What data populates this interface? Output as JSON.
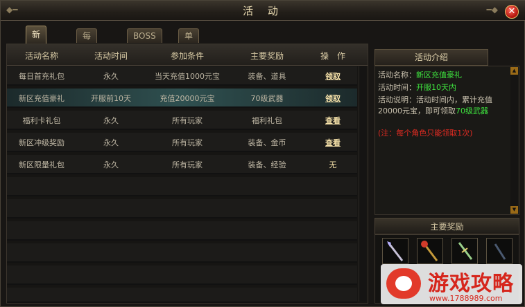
{
  "window": {
    "title": "活 动"
  },
  "tabs": [
    "新区活动",
    "每日活动",
    "BOSS信息",
    "单人副本"
  ],
  "table": {
    "headers": [
      "活动名称",
      "活动时间",
      "参加条件",
      "主要奖励",
      "操　作"
    ],
    "rows": [
      {
        "name": "每日首充礼包",
        "time": "永久",
        "cond": "当天充值1000元宝",
        "reward": "装备、道具",
        "op": "领取"
      },
      {
        "name": "新区充值豪礼",
        "time": "开服前10天",
        "cond": "充值20000元宝",
        "reward": "70级武器",
        "op": "领取"
      },
      {
        "name": "福利卡礼包",
        "time": "永久",
        "cond": "所有玩家",
        "reward": "福利礼包",
        "op": "查看"
      },
      {
        "name": "新区冲级奖励",
        "time": "永久",
        "cond": "所有玩家",
        "reward": "装备、金币",
        "op": "查看"
      },
      {
        "name": "新区限量礼包",
        "time": "永久",
        "cond": "所有玩家",
        "reward": "装备、经验",
        "op": "无"
      }
    ]
  },
  "info": {
    "title": "活动介绍",
    "name_label": "活动名称：",
    "name_value": "新区充值豪礼",
    "time_label": "活动时间：",
    "time_value": "开服10天内",
    "desc_label": "活动说明：活动时间内，累计充值",
    "desc_line2": "20000元宝，即可领取",
    "desc_value": "70级武器",
    "note": "(注：每个角色只能领取1次)"
  },
  "rewards": {
    "title": "主要奖励",
    "icons": [
      "spear-icon",
      "staff-icon",
      "sword-icon",
      "blade-icon"
    ]
  },
  "watermark": {
    "text": "游戏攻略",
    "url": "www.1788989.com"
  },
  "colors": {
    "accent_green": "#3ee23e",
    "note_red": "#e22b22",
    "link_gold": "#f4e0a8"
  }
}
